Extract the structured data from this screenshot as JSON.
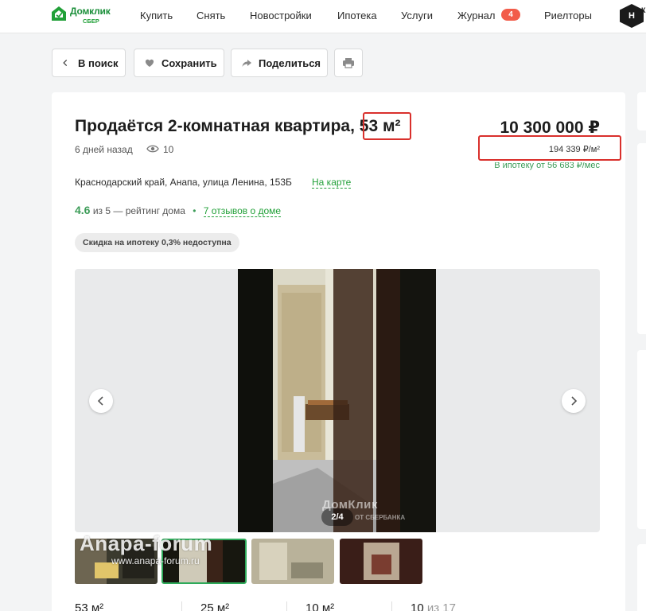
{
  "header": {
    "logo_text": "Домклик",
    "logo_sub": "СБЕР",
    "nav": [
      {
        "label": "Купить"
      },
      {
        "label": "Снять"
      },
      {
        "label": "Новостройки"
      },
      {
        "label": "Ипотека"
      },
      {
        "label": "Услуги"
      },
      {
        "label": "Журнал",
        "badge": "4"
      },
      {
        "label": "Риелторы"
      }
    ],
    "corner_logo": "H",
    "corner_text": "К"
  },
  "actions": {
    "back": "В поиск",
    "save": "Сохранить",
    "share": "Поделиться"
  },
  "listing": {
    "title_prefix": "Продаётся 2-комнатная квартира, ",
    "area": "53 м²",
    "posted": "6 дней назад",
    "views": "10",
    "price": "10 300 000 ₽",
    "price_per_m2": "194 339 ₽/м²",
    "mortgage": "В ипотеку от 56 683 ₽/мес",
    "address": "Краснодарский край, Анапа, улица Ленина, 153Б",
    "map_link": "На карте",
    "rating": "4.6",
    "rating_text": "из 5 — рейтинг дома",
    "reviews_link": "7 отзывов о доме",
    "chip": "Скидка на ипотеку 0,3% недоступна"
  },
  "gallery": {
    "counter": "2/4",
    "photo_watermark": "ДомКлик",
    "photo_watermark_sub": "ОТ СБЕРБАНКА"
  },
  "watermark": {
    "site": "Anapa-forum",
    "url": "www.anapa-forum.ru"
  },
  "stats": {
    "total": "53 м²",
    "living": "25 м²",
    "kitchen": "10 м²",
    "floor": "10",
    "floor_of": "из 17"
  },
  "colors": {
    "brand_green": "#21a038",
    "highlight_red": "#d9302c",
    "badge_red": "#f25c4a"
  }
}
